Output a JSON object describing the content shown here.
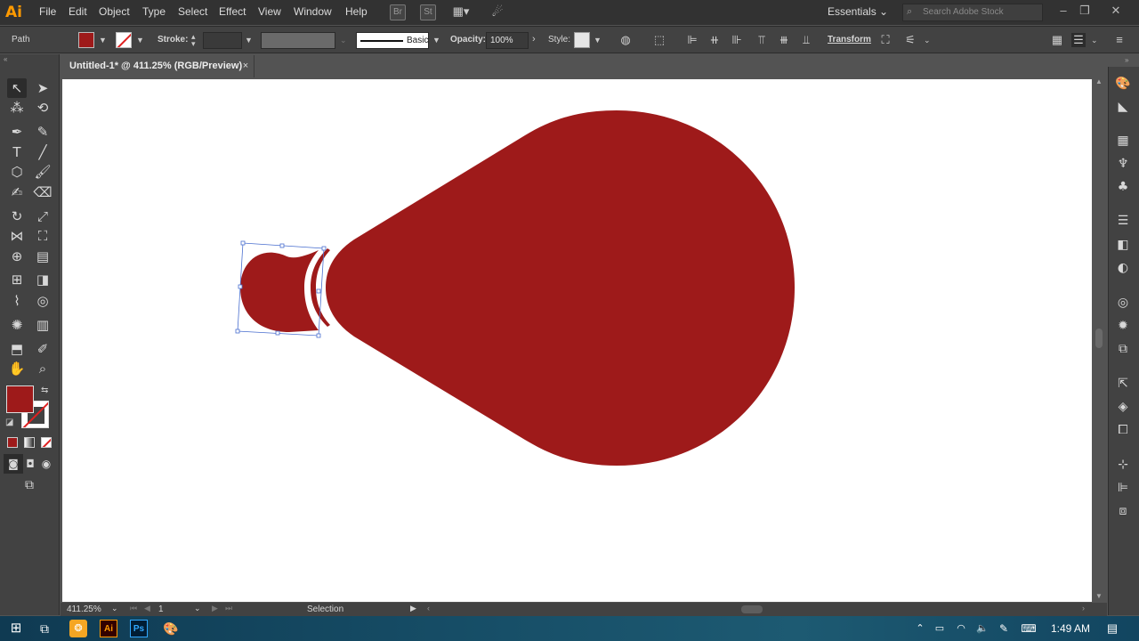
{
  "app": {
    "logo": "Ai"
  },
  "menu": [
    "File",
    "Edit",
    "Object",
    "Type",
    "Select",
    "Effect",
    "View",
    "Window",
    "Help"
  ],
  "menubar_icons": {
    "bridge": "Br",
    "stock": "St"
  },
  "workspace": "Essentials",
  "search": {
    "placeholder": "Search Adobe Stock"
  },
  "control_bar": {
    "selection_type": "Path",
    "fill_color": "#9e1a1a",
    "stroke_label": "Stroke:",
    "stroke_profile": "Basic",
    "opacity_label": "Opacity:",
    "opacity_value": "100%",
    "style_label": "Style:",
    "transform_label": "Transform"
  },
  "document_tab": {
    "title": "Untitled-1* @ 411.25% (RGB/Preview)",
    "close": "×"
  },
  "artwork": {
    "shape_color": "#9e1a1a",
    "selection_color": "#4a6fcf"
  },
  "status_bar": {
    "zoom": "411.25%",
    "artboard_number": "1",
    "tool": "Selection"
  },
  "taskbar": {
    "time": "1:49 AM"
  }
}
